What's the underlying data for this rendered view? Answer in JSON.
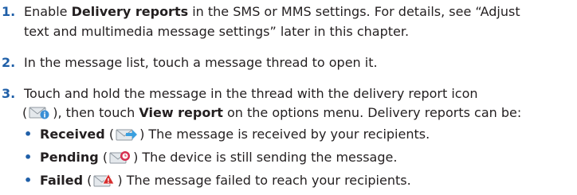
{
  "steps": [
    {
      "number": "1.",
      "pre": "Enable ",
      "bold": "Delivery reports",
      "post": " in the SMS or MMS settings. For details, see “Adjust",
      "line2": "text and multimedia message settings” later in this chapter."
    },
    {
      "number": "2.",
      "text": "In the message list, touch a message thread to open it."
    },
    {
      "number": "3.",
      "line1": "Touch and hold the message in the thread with the delivery report icon",
      "line2_pre": "(",
      "line2_mid": "), then touch ",
      "line2_bold": "View report",
      "line2_post": " on the options menu. Delivery reports can be:"
    }
  ],
  "statuses": [
    {
      "label": "Received",
      "paren_open": " (",
      "paren_close": ") ",
      "description": "The message is received by your recipients.",
      "icon": "received-report-icon"
    },
    {
      "label": "Pending",
      "paren_open": " (",
      "paren_close": ") ",
      "description": "The device is still sending the message.",
      "icon": "pending-report-icon"
    },
    {
      "label": "Failed",
      "paren_open": " (",
      "paren_close": ") ",
      "description": "The message failed to reach your recipients.",
      "icon": "failed-report-icon"
    }
  ],
  "colors": {
    "accent": "#1f5fa8",
    "text": "#231f20",
    "info_badge": "#3a8fd6",
    "pending_badge": "#d62e4f",
    "failed_badge": "#d62e2e"
  }
}
